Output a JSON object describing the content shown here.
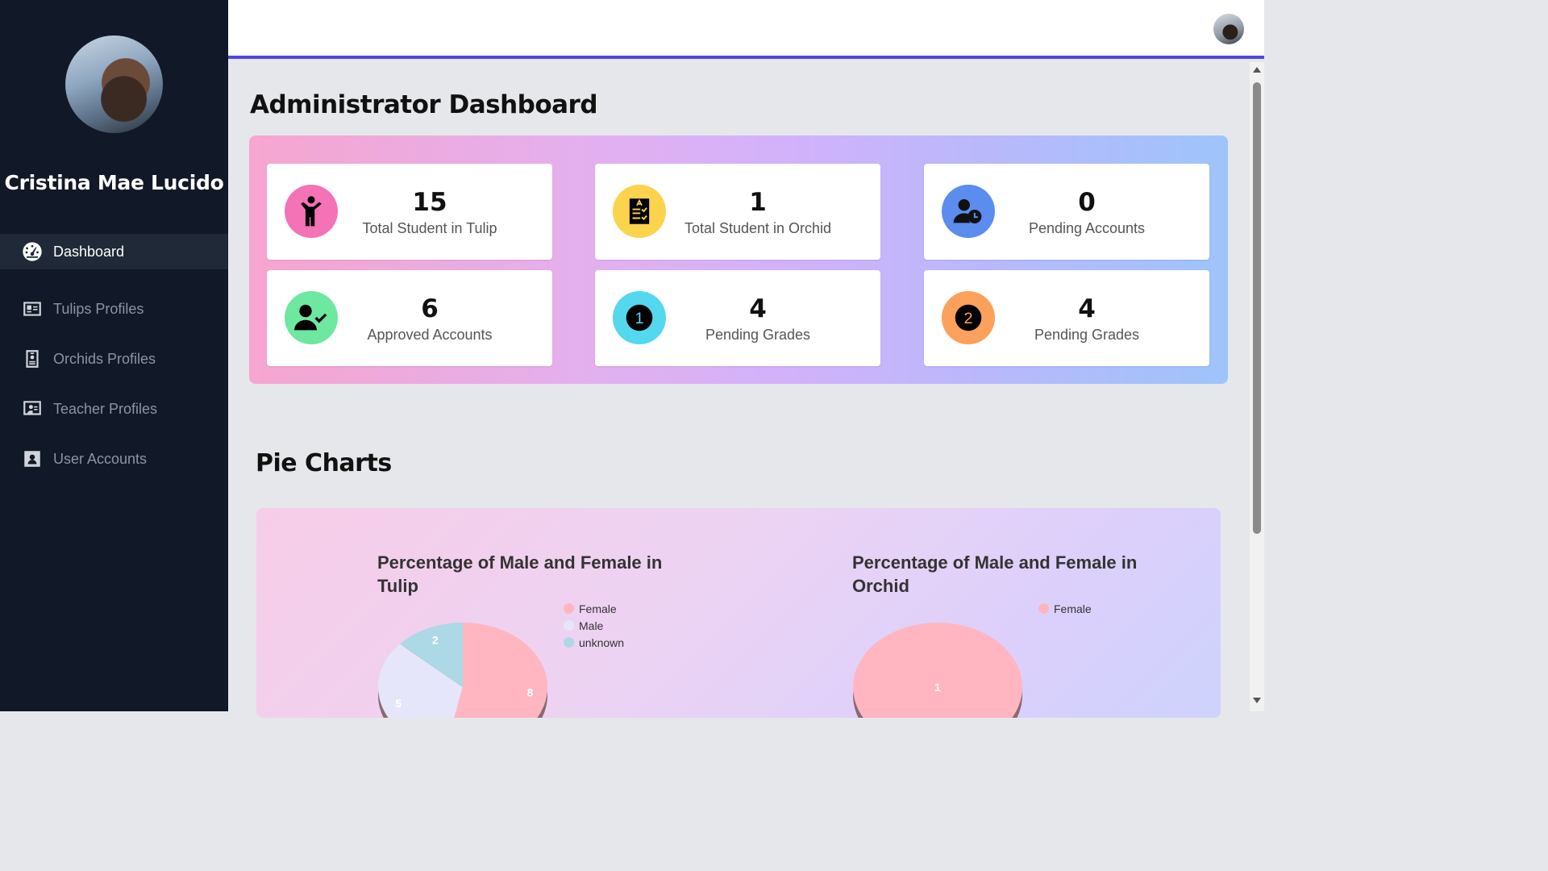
{
  "sidebar": {
    "user_name": "Cristina Mae Lucido",
    "items": [
      {
        "label": "Dashboard",
        "icon": "gauge-icon",
        "active": true
      },
      {
        "label": "Tulips Profiles",
        "icon": "id-card-icon",
        "active": false
      },
      {
        "label": "Orchids Profiles",
        "icon": "id-badge-icon",
        "active": false
      },
      {
        "label": "Teacher Profiles",
        "icon": "chalkboard-teacher-icon",
        "active": false
      },
      {
        "label": "User Accounts",
        "icon": "user-square-icon",
        "active": false
      }
    ]
  },
  "header": {
    "avatar": "user-avatar"
  },
  "main": {
    "title": "Administrator Dashboard",
    "stats": [
      {
        "value": "15",
        "label": "Total Student in Tulip",
        "icon": "child-icon",
        "color": "#f472b6"
      },
      {
        "value": "1",
        "label": "Total Student in Orchid",
        "icon": "clipboard-check-icon",
        "color": "#fcd34d"
      },
      {
        "value": "0",
        "label": "Pending Accounts",
        "icon": "user-clock-icon",
        "color": "#5b8def"
      },
      {
        "value": "6",
        "label": "Approved Accounts",
        "icon": "user-check-icon",
        "color": "#6ee7a0"
      },
      {
        "value": "4",
        "label": "Pending Grades",
        "icon": "number-one-icon",
        "color": "#53d8ee"
      },
      {
        "value": "4",
        "label": "Pending Grades",
        "icon": "number-two-icon",
        "color": "#fba15c"
      }
    ],
    "section_title": "Pie Charts"
  },
  "chart_data": [
    {
      "type": "pie",
      "title": "Percentage of Male and Female in Tulip",
      "categories": [
        "Female",
        "Male",
        "unknown"
      ],
      "values": [
        8,
        5,
        2
      ],
      "colors": [
        "#ffb6c1",
        "#e6e6fa",
        "#add8e6"
      ],
      "legend_position": "top-right"
    },
    {
      "type": "pie",
      "title": "Percentage of Male and Female in Orchid",
      "categories": [
        "Female"
      ],
      "values": [
        1
      ],
      "colors": [
        "#ffb6c1"
      ],
      "legend_position": "top-right"
    }
  ]
}
